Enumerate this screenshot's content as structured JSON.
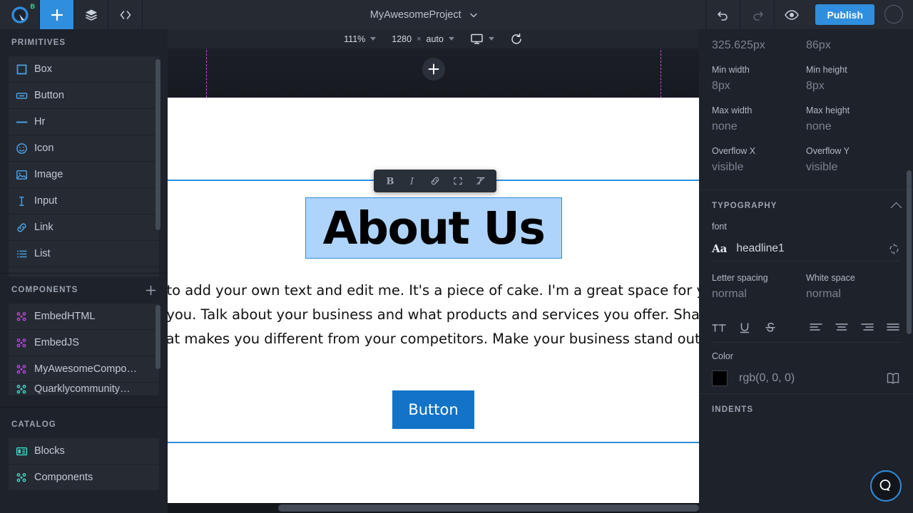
{
  "topbar": {
    "logo_icon": "quarkly-logo-icon",
    "beta_label": "B",
    "add_icon": "plus-icon",
    "layers_icon": "layers-icon",
    "code_icon": "code-brackets-icon",
    "project_title": "MyAwesomeProject",
    "project_caret_icon": "chevron-down-icon",
    "undo_icon": "undo-arrow-icon",
    "redo_icon": "redo-arrow-icon",
    "preview_icon": "eye-icon",
    "publish_label": "Publish",
    "avatar": "user-avatar"
  },
  "sidebar": {
    "primitives": {
      "title": "PRIMITIVES",
      "items": [
        {
          "label": "Box",
          "icon": "box-icon"
        },
        {
          "label": "Button",
          "icon": "button-icon"
        },
        {
          "label": "Hr",
          "icon": "horizontal-rule-icon"
        },
        {
          "label": "Icon",
          "icon": "smiley-icon"
        },
        {
          "label": "Image",
          "icon": "image-icon"
        },
        {
          "label": "Input",
          "icon": "text-cursor-icon"
        },
        {
          "label": "Link",
          "icon": "link-chain-icon"
        },
        {
          "label": "List",
          "icon": "list-icon"
        }
      ]
    },
    "components": {
      "title": "COMPONENTS",
      "add_icon": "plus-icon",
      "items": [
        {
          "label": "EmbedHTML",
          "icon": "component-icon"
        },
        {
          "label": "EmbedJS",
          "icon": "component-icon"
        },
        {
          "label": "MyAwesomeCompo…",
          "icon": "component-icon"
        },
        {
          "label": "Quarklycommunity…",
          "icon": "component-icon"
        }
      ]
    },
    "catalog": {
      "title": "CATALOG",
      "items": [
        {
          "label": "Blocks",
          "icon": "blocks-icon"
        },
        {
          "label": "Components",
          "icon": "component-icon"
        }
      ]
    }
  },
  "canvas_toolbar": {
    "zoom_value": "111%",
    "zoom_caret_icon": "chevron-down-icon",
    "width_value": "1280",
    "multiply_symbol": "×",
    "height_value": "auto",
    "size_caret_icon": "chevron-down-icon",
    "device_icon": "monitor-icon",
    "device_caret_icon": "chevron-down-icon",
    "reload_icon": "refresh-icon"
  },
  "canvas": {
    "hero_add_icon": "plus-icon",
    "format_toolbar": [
      {
        "name": "bold-icon",
        "glyph": "B"
      },
      {
        "name": "italic-icon",
        "glyph": "I"
      },
      {
        "name": "link-icon",
        "glyph": "link"
      },
      {
        "name": "code-block-icon",
        "glyph": "brackets"
      },
      {
        "name": "clear-format-icon",
        "glyph": "clear"
      }
    ],
    "heading_text": "About Us",
    "body_lines": [
      "re to add your own text and edit me. It's a piece of cake. I'm a great space for you",
      "t you. Talk about your business and what products and services you offer. Share",
      "hat makes you different from your competitors. Make your business stand out a"
    ],
    "cta_label": "Button"
  },
  "right_panel": {
    "size": {
      "width_value": "325.625px",
      "height_value": "86px",
      "min_width_label": "Min width",
      "min_width_value": "8px",
      "min_height_label": "Min height",
      "min_height_value": "8px",
      "max_width_label": "Max width",
      "max_width_value": "none",
      "max_height_label": "Max height",
      "max_height_value": "none",
      "overflow_x_label": "Overflow X",
      "overflow_x_value": "visible",
      "overflow_y_label": "Overflow Y",
      "overflow_y_value": "visible"
    },
    "typography": {
      "title": "TYPOGRAPHY",
      "collapse_icon": "chevron-up-icon",
      "font_label": "font",
      "font_aa_icon": "font-aa-icon",
      "font_value": "headline1",
      "font_reset_icon": "reset-icon",
      "letter_spacing_label": "Letter spacing",
      "letter_spacing_value": "normal",
      "white_space_label": "White space",
      "white_space_value": "normal",
      "style_icons": [
        {
          "name": "uppercase-icon"
        },
        {
          "name": "underline-icon"
        },
        {
          "name": "strikethrough-icon"
        }
      ],
      "align_icons": [
        {
          "name": "align-left-icon"
        },
        {
          "name": "align-center-icon"
        },
        {
          "name": "align-right-icon"
        },
        {
          "name": "align-justify-icon"
        }
      ],
      "color_label": "Color",
      "color_value": "rgb(0, 0, 0)",
      "color_swatch_hex": "#000000",
      "color_book_icon": "palette-book-icon"
    },
    "indents": {
      "title": "INDENTS"
    }
  },
  "help": {
    "icon": "help-chat-icon"
  },
  "colors": {
    "accent_blue": "#2f8ede",
    "panel_bg": "#1e222a",
    "topbar_bg": "#252a33",
    "item_bg": "#252a33",
    "guide_magenta": "#e040fb",
    "component_purple": "#b44ae0",
    "catalog_teal": "#3ddcc6"
  }
}
